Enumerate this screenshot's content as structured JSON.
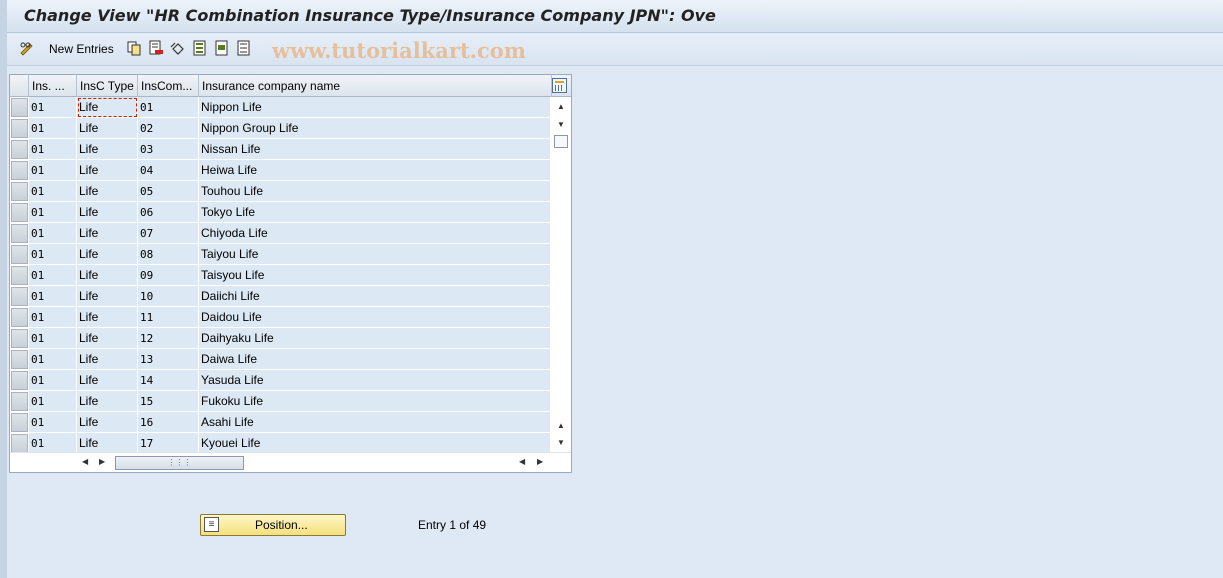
{
  "window": {
    "title": "Change View \"HR Combination Insurance Type/Insurance Company JPN\": Ove"
  },
  "toolbar": {
    "new_entries_label": "New Entries",
    "icons": [
      "pencil-glasses-icon",
      "copy-icon",
      "delete-icon",
      "undo-icon",
      "select-all-icon",
      "select-block-icon",
      "deselect-all-icon"
    ]
  },
  "watermark": "www.tutorialkart.com",
  "table": {
    "columns": [
      "Ins. ...",
      "InsC Type",
      "InsCom...",
      "Insurance company name"
    ],
    "rows": [
      [
        "01",
        "Life",
        "01",
        "Nippon Life"
      ],
      [
        "01",
        "Life",
        "02",
        "Nippon Group Life"
      ],
      [
        "01",
        "Life",
        "03",
        "Nissan Life"
      ],
      [
        "01",
        "Life",
        "04",
        "Heiwa Life"
      ],
      [
        "01",
        "Life",
        "05",
        "Touhou Life"
      ],
      [
        "01",
        "Life",
        "06",
        "Tokyo Life"
      ],
      [
        "01",
        "Life",
        "07",
        "Chiyoda Life"
      ],
      [
        "01",
        "Life",
        "08",
        "Taiyou Life"
      ],
      [
        "01",
        "Life",
        "09",
        "Taisyou Life"
      ],
      [
        "01",
        "Life",
        "10",
        "Daiichi Life"
      ],
      [
        "01",
        "Life",
        "11",
        "Daidou Life"
      ],
      [
        "01",
        "Life",
        "12",
        "Daihyaku Life"
      ],
      [
        "01",
        "Life",
        "13",
        "Daiwa Life"
      ],
      [
        "01",
        "Life",
        "14",
        "Yasuda Life"
      ],
      [
        "01",
        "Life",
        "15",
        "Fukoku Life"
      ],
      [
        "01",
        "Life",
        "16",
        "Asahi Life"
      ],
      [
        "01",
        "Life",
        "17",
        "Kyouei Life"
      ]
    ]
  },
  "footer": {
    "position_button_label": "Position...",
    "entry_info": "Entry 1 of 49"
  },
  "colors": {
    "cell_bg": "#dce8f3",
    "window_bg": "#dfe9f5",
    "button_bg": "#f4e07c"
  }
}
